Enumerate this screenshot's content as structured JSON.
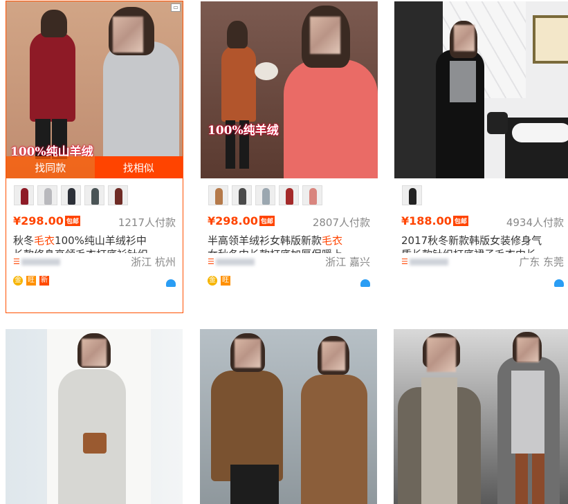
{
  "products": [
    {
      "price": "¥298.00",
      "badge": "包邮",
      "sold": "1217人付款",
      "title_parts": [
        "秋冬",
        "毛衣",
        "100%纯山羊绒衫中"
      ],
      "title_line2": "长款修身高领毛衣打底衫针织",
      "location": "浙江 杭州",
      "banner": "100%纯山羊绒",
      "hover_left": "找同款",
      "hover_right": "找相似",
      "shop_icon": "☰",
      "badges": [
        "金",
        "旺",
        "新"
      ],
      "swatch_colors": [
        "#8e1a26",
        "#b9b9bd",
        "#2c3038",
        "#4a5456",
        "#6e2b25"
      ]
    },
    {
      "price": "¥298.00",
      "badge": "包邮",
      "sold": "2807人付款",
      "title_parts": [
        "半高领羊绒衫女韩版新款",
        "毛衣",
        ""
      ],
      "title_line2": "女秋冬中长款打底加厚保暖上",
      "location": "浙江 嘉兴",
      "banner": "100%纯羊绒",
      "shop_icon": "☰",
      "badges": [
        "金",
        "旺"
      ],
      "swatch_colors": [
        "#b57a4a",
        "#4a4a4a",
        "#9ba7b0",
        "#a42a2a",
        "#d9857e"
      ]
    },
    {
      "price": "¥188.00",
      "badge": "包邮",
      "sold": "4934人付款",
      "title_parts": [
        "2017秋冬新款韩版女装修身气",
        "",
        ""
      ],
      "title_line2": "质长款针织打底裙子毛衣中长",
      "location": "广东 东莞",
      "shop_icon": "☰",
      "badges": [],
      "swatch_colors": [
        "#222222"
      ]
    }
  ],
  "colors": {
    "accent": "#ff4400",
    "hover_border": "#ff5000",
    "wangwang": "#2a9df4"
  }
}
